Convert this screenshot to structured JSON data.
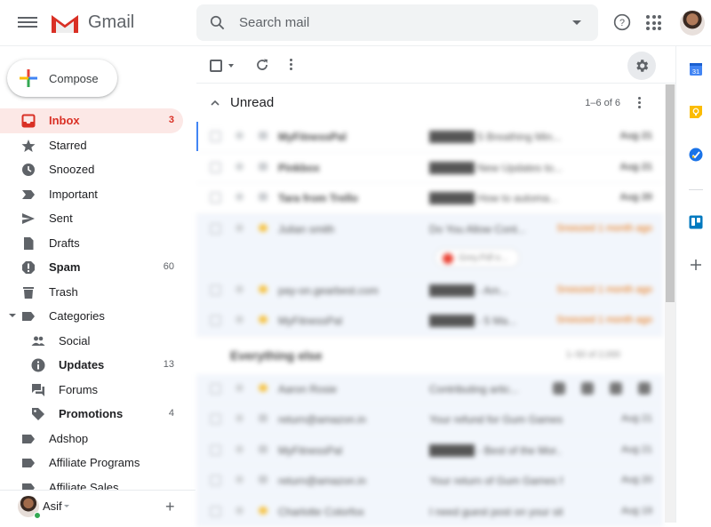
{
  "app": {
    "name": "Gmail",
    "brand_color": "#d93025",
    "accent_color": "#1a73e8"
  },
  "header": {
    "search_placeholder": "Search mail",
    "icons": [
      "menu-icon",
      "gmail-logo-icon",
      "search-icon",
      "search-options-icon",
      "help-icon",
      "apps-icon",
      "account-avatar"
    ]
  },
  "compose": {
    "label": "Compose"
  },
  "sidebar": {
    "items": [
      {
        "label": "Inbox",
        "count": "3",
        "icon": "inbox-icon",
        "active": true
      },
      {
        "label": "Starred",
        "count": "",
        "icon": "star-icon"
      },
      {
        "label": "Snoozed",
        "count": "",
        "icon": "clock-icon"
      },
      {
        "label": "Important",
        "count": "",
        "icon": "important-icon"
      },
      {
        "label": "Sent",
        "count": "",
        "icon": "send-icon"
      },
      {
        "label": "Drafts",
        "count": "",
        "icon": "draft-icon"
      },
      {
        "label": "Spam",
        "count": "60",
        "icon": "spam-icon",
        "bold": true
      },
      {
        "label": "Trash",
        "count": "",
        "icon": "trash-icon"
      },
      {
        "label": "Categories",
        "count": "",
        "icon": "label-icon",
        "expanded": true
      },
      {
        "label": "Social",
        "count": "",
        "icon": "people-icon",
        "sub": true
      },
      {
        "label": "Updates",
        "count": "13",
        "icon": "info-icon",
        "sub": true,
        "bold": true
      },
      {
        "label": "Forums",
        "count": "",
        "icon": "forum-icon",
        "sub": true
      },
      {
        "label": "Promotions",
        "count": "4",
        "icon": "tag-icon",
        "sub": true,
        "bold": true
      },
      {
        "label": "Adshop",
        "count": "",
        "icon": "label-icon"
      },
      {
        "label": "Affiliate Programs",
        "count": "",
        "icon": "label-icon"
      },
      {
        "label": "Affiliate Sales",
        "count": "",
        "icon": "label-icon"
      }
    ],
    "footer": {
      "user_name": "Asif",
      "status": "online"
    }
  },
  "toolbar": {
    "icons": [
      "select-checkbox",
      "select-dropdown-icon",
      "refresh-icon",
      "more-icon",
      "settings-icon"
    ]
  },
  "sections": [
    {
      "title": "Unread",
      "range": "1–6 of 6",
      "expanded": true,
      "rows_blurred": true,
      "rows": [
        {
          "sender": "MyFitnessPal",
          "subject": "██████ 5 Breathing Min...",
          "date": "Aug 21",
          "unread": true
        },
        {
          "sender": "Pinkbox",
          "subject": "██████ New Updates to...",
          "date": "Aug 21",
          "unread": true
        },
        {
          "sender": "Tara from Trello",
          "subject": "██████ How to automa...",
          "date": "Aug 20",
          "unread": true
        },
        {
          "sender": "Julian smith",
          "subject": "Do You Allow Cont...",
          "date": "Snoozed 1 month ago",
          "snoozed": true,
          "important": true,
          "attachment": "Grey.Pdf e..."
        },
        {
          "sender": "pay-on.gearbest.com",
          "subject": "██████ - Am...",
          "date": "Snoozed 1 month ago",
          "snoozed": true,
          "important": true
        },
        {
          "sender": "MyFitnessPal",
          "subject": "██████ - 5 Ma...",
          "date": "Snoozed 1 month ago",
          "snoozed": true,
          "important": true
        }
      ]
    },
    {
      "title": "Everything else",
      "range": "1–50 of 2,000",
      "rows": [
        {
          "sender": "Aaron Rosie",
          "subject": "Contributing artic...",
          "date": "",
          "important": true,
          "hover_actions": [
            "archive-icon",
            "delete-icon",
            "mark-read-icon",
            "snooze-icon"
          ]
        },
        {
          "sender": "return@amazon.in",
          "subject": "Your refund for Gum Games ...",
          "date": "Aug 21"
        },
        {
          "sender": "MyFitnessPal",
          "subject": "██████ - Best of the Mor...",
          "date": "Aug 21"
        },
        {
          "sender": "return@amazon.in",
          "subject": "Your return of Gum Games fr...",
          "date": "Aug 20"
        },
        {
          "sender": "Charlotte Colorfox",
          "subject": "I need guest post on your sit...",
          "date": "Aug 19",
          "important": true
        }
      ]
    }
  ],
  "side_panel": {
    "apps": [
      "calendar-icon",
      "keep-icon",
      "tasks-icon",
      "trello-icon",
      "add-addon-icon"
    ],
    "calendar_day": "31"
  }
}
